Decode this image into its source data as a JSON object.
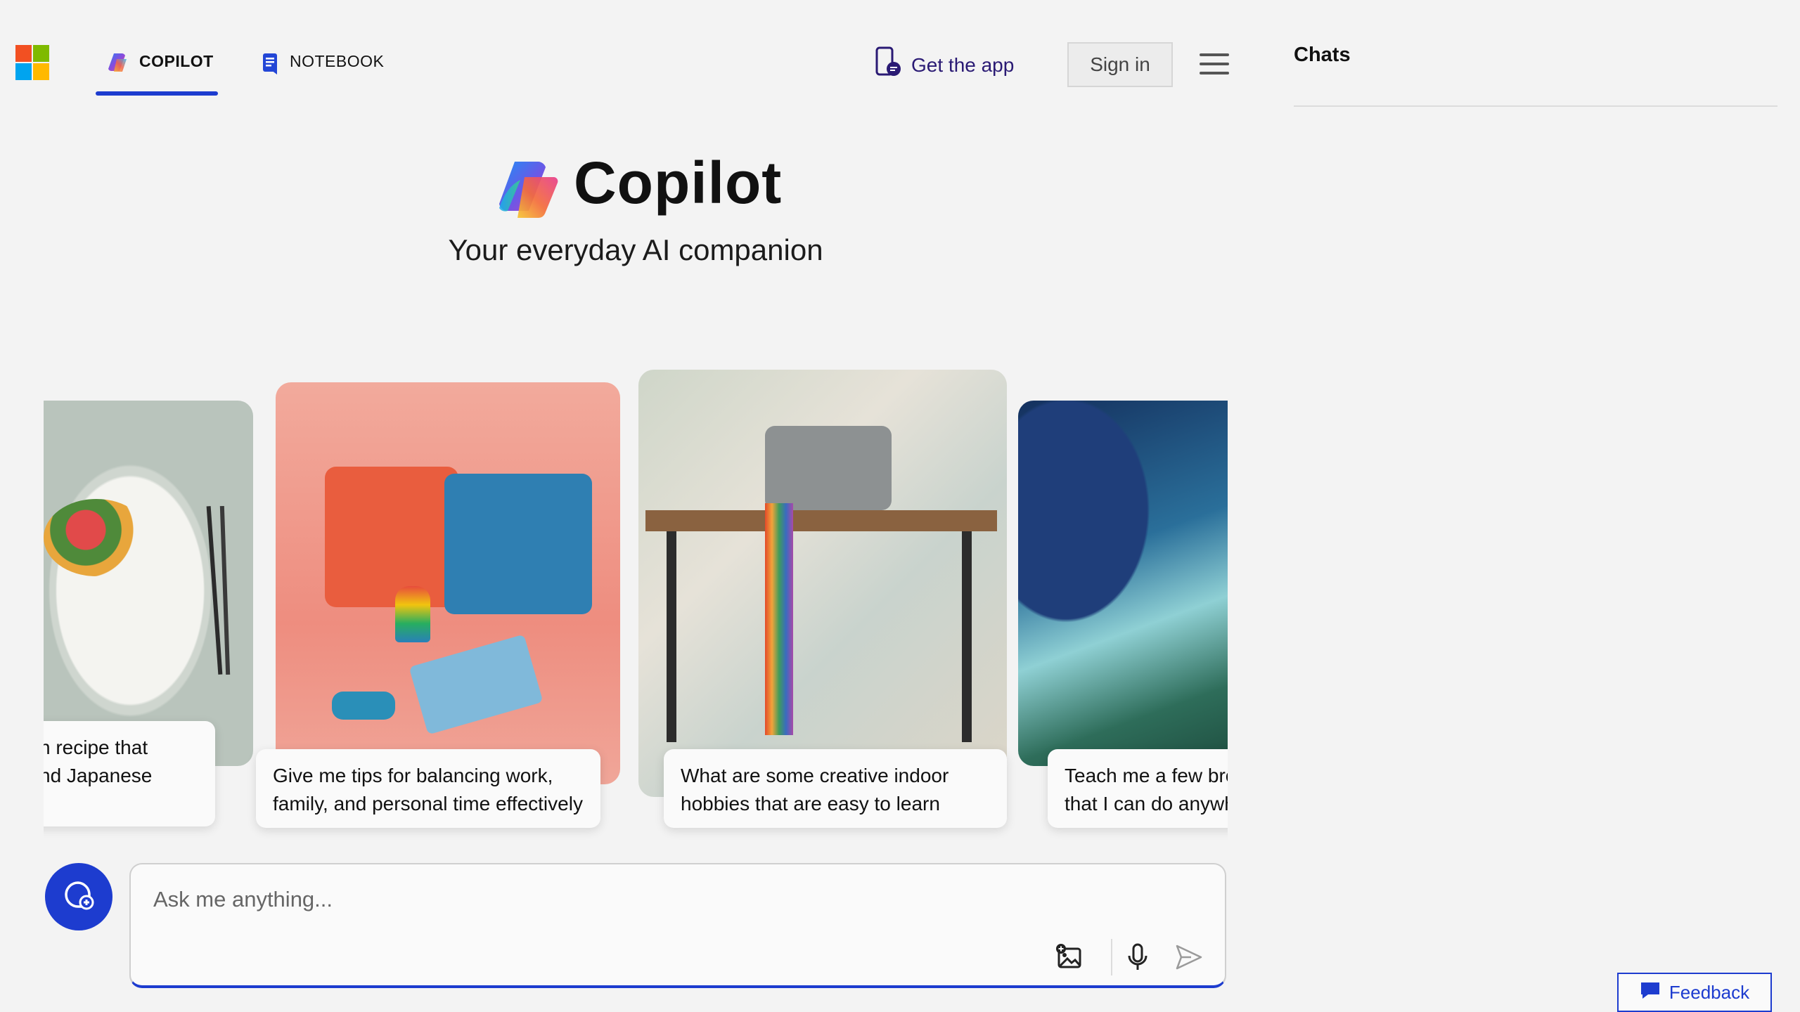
{
  "header": {
    "tabs": [
      {
        "label": "COPILOT",
        "icon": "copilot-icon",
        "active": true
      },
      {
        "label": "NOTEBOOK",
        "icon": "notebook-icon",
        "active": false
      }
    ],
    "get_app_label": "Get the app",
    "sign_in_label": "Sign in"
  },
  "sidebar": {
    "title": "Chats"
  },
  "hero": {
    "title": "Copilot",
    "subtitle": "Your everyday AI companion"
  },
  "suggestions": [
    {
      "line1": "n recipe that",
      "line2": "nd Japanese",
      "image": "food-plate-image"
    },
    {
      "line1": "Give me tips for balancing work,",
      "line2": "family, and personal time effectively",
      "image": "briefcase-toys-image"
    },
    {
      "line1": "What are some creative indoor",
      "line2": "hobbies that are easy to learn",
      "image": "sewing-machine-image"
    },
    {
      "line1": "Teach me a few bre",
      "line2": "that I can do anywh",
      "image": "waves-image"
    }
  ],
  "composer": {
    "placeholder": "Ask me anything..."
  },
  "feedback_label": "Feedback",
  "colors": {
    "accent": "#1d3ccf",
    "background": "#f3f3f3",
    "get_app_text": "#2a1a74"
  }
}
